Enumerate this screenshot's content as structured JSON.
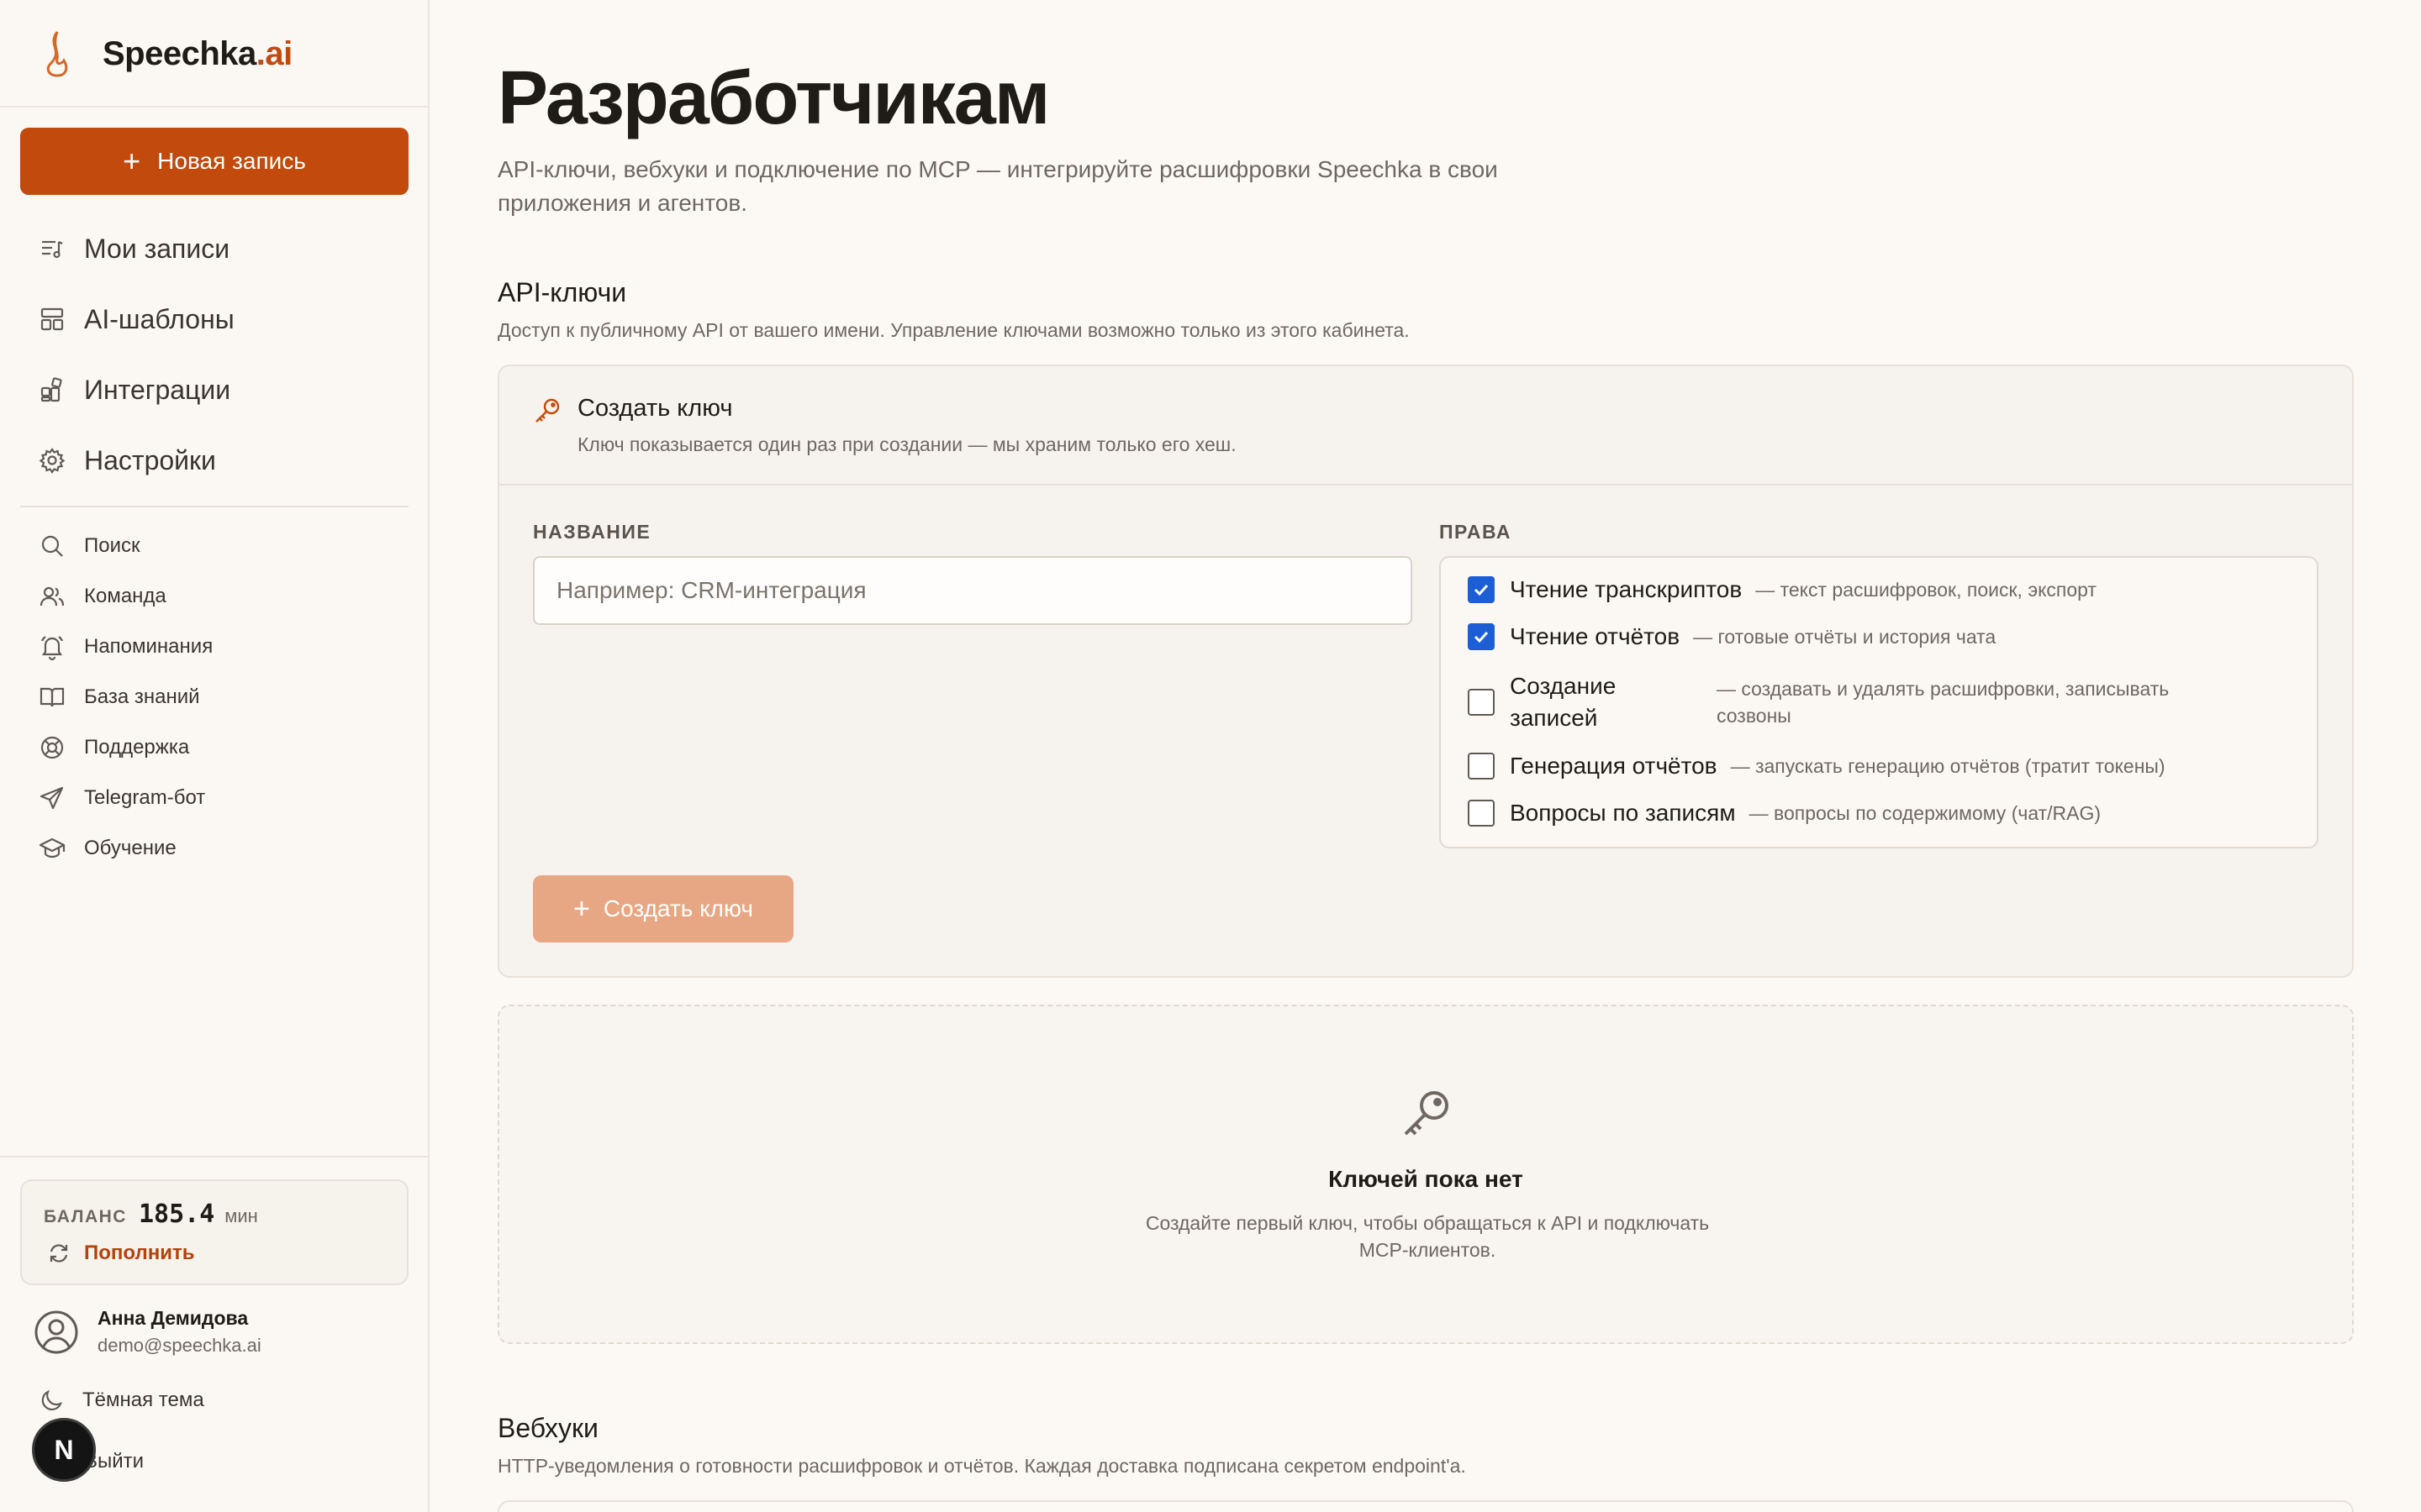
{
  "brand": {
    "name": "Speechka",
    "tld": ".ai"
  },
  "sidebar": {
    "new_record": "Новая запись",
    "main_items": [
      {
        "label": "Мои записи",
        "icon": "records-list-icon"
      },
      {
        "label": "AI-шаблоны",
        "icon": "template-icon"
      },
      {
        "label": "Интеграции",
        "icon": "integrations-icon"
      },
      {
        "label": "Настройки",
        "icon": "gear-icon"
      }
    ],
    "sub_items": [
      {
        "label": "Поиск",
        "icon": "search-icon"
      },
      {
        "label": "Команда",
        "icon": "team-icon"
      },
      {
        "label": "Напоминания",
        "icon": "bell-icon"
      },
      {
        "label": "База знаний",
        "icon": "book-icon"
      },
      {
        "label": "Поддержка",
        "icon": "lifebuoy-icon"
      },
      {
        "label": "Telegram-бот",
        "icon": "send-icon"
      },
      {
        "label": "Обучение",
        "icon": "graduation-cap-icon"
      }
    ],
    "balance": {
      "label": "БАЛАНС",
      "value": "185.4",
      "unit": "мин",
      "topup": "Пополнить"
    },
    "user": {
      "name": "Анна Демидова",
      "email": "demo@speechka.ai"
    },
    "theme_toggle": "Тёмная тема",
    "logout": "Выйти",
    "badge": "N"
  },
  "page": {
    "title": "Разработчикам",
    "description": "API-ключи, вебхуки и подключение по MCP — интегрируйте расшифровки Speechka в свои приложения и агентов."
  },
  "api_keys": {
    "title": "API-ключи",
    "description": "Доступ к публичному API от вашего имени. Управление ключами возможно только из этого кабинета.",
    "create_card": {
      "title": "Создать ключ",
      "subtitle": "Ключ показывается один раз при создании — мы храним только его хеш.",
      "name_label": "НАЗВАНИЕ",
      "name_placeholder": "Например: CRM-интеграция",
      "name_value": "",
      "perms_label": "ПРАВА",
      "permissions": [
        {
          "name": "Чтение транскриптов",
          "desc": "— текст расшифровок, поиск, экспорт",
          "checked": true
        },
        {
          "name": "Чтение отчётов",
          "desc": "— готовые отчёты и история чата",
          "checked": true
        },
        {
          "name_line1": "Создание",
          "name_line2": "записей",
          "desc_line1": "— создавать и удалять расшифровки, записывать",
          "desc_line2": "созвоны",
          "checked": false
        },
        {
          "name": "Генерация отчётов",
          "desc": "— запускать генерацию отчётов (тратит токены)",
          "checked": false
        },
        {
          "name": "Вопросы по записям",
          "desc": "— вопросы по содержимому (чат/RAG)",
          "checked": false
        }
      ],
      "submit": "Создать ключ"
    },
    "empty": {
      "title": "Ключей пока нет",
      "line1": "Создайте первый ключ, чтобы обращаться к API и подключать",
      "line2": "MCP-клиентов."
    }
  },
  "webhooks": {
    "title": "Вебхуки",
    "description": "HTTP-уведомления о готовности расшифровок и отчётов. Каждая доставка подписана секретом endpoint'a."
  },
  "colors": {
    "accent": "#c24a0c",
    "accent_disabled": "#e8a784",
    "checkbox": "#1c5ed6",
    "background": "#fcf9f5"
  }
}
